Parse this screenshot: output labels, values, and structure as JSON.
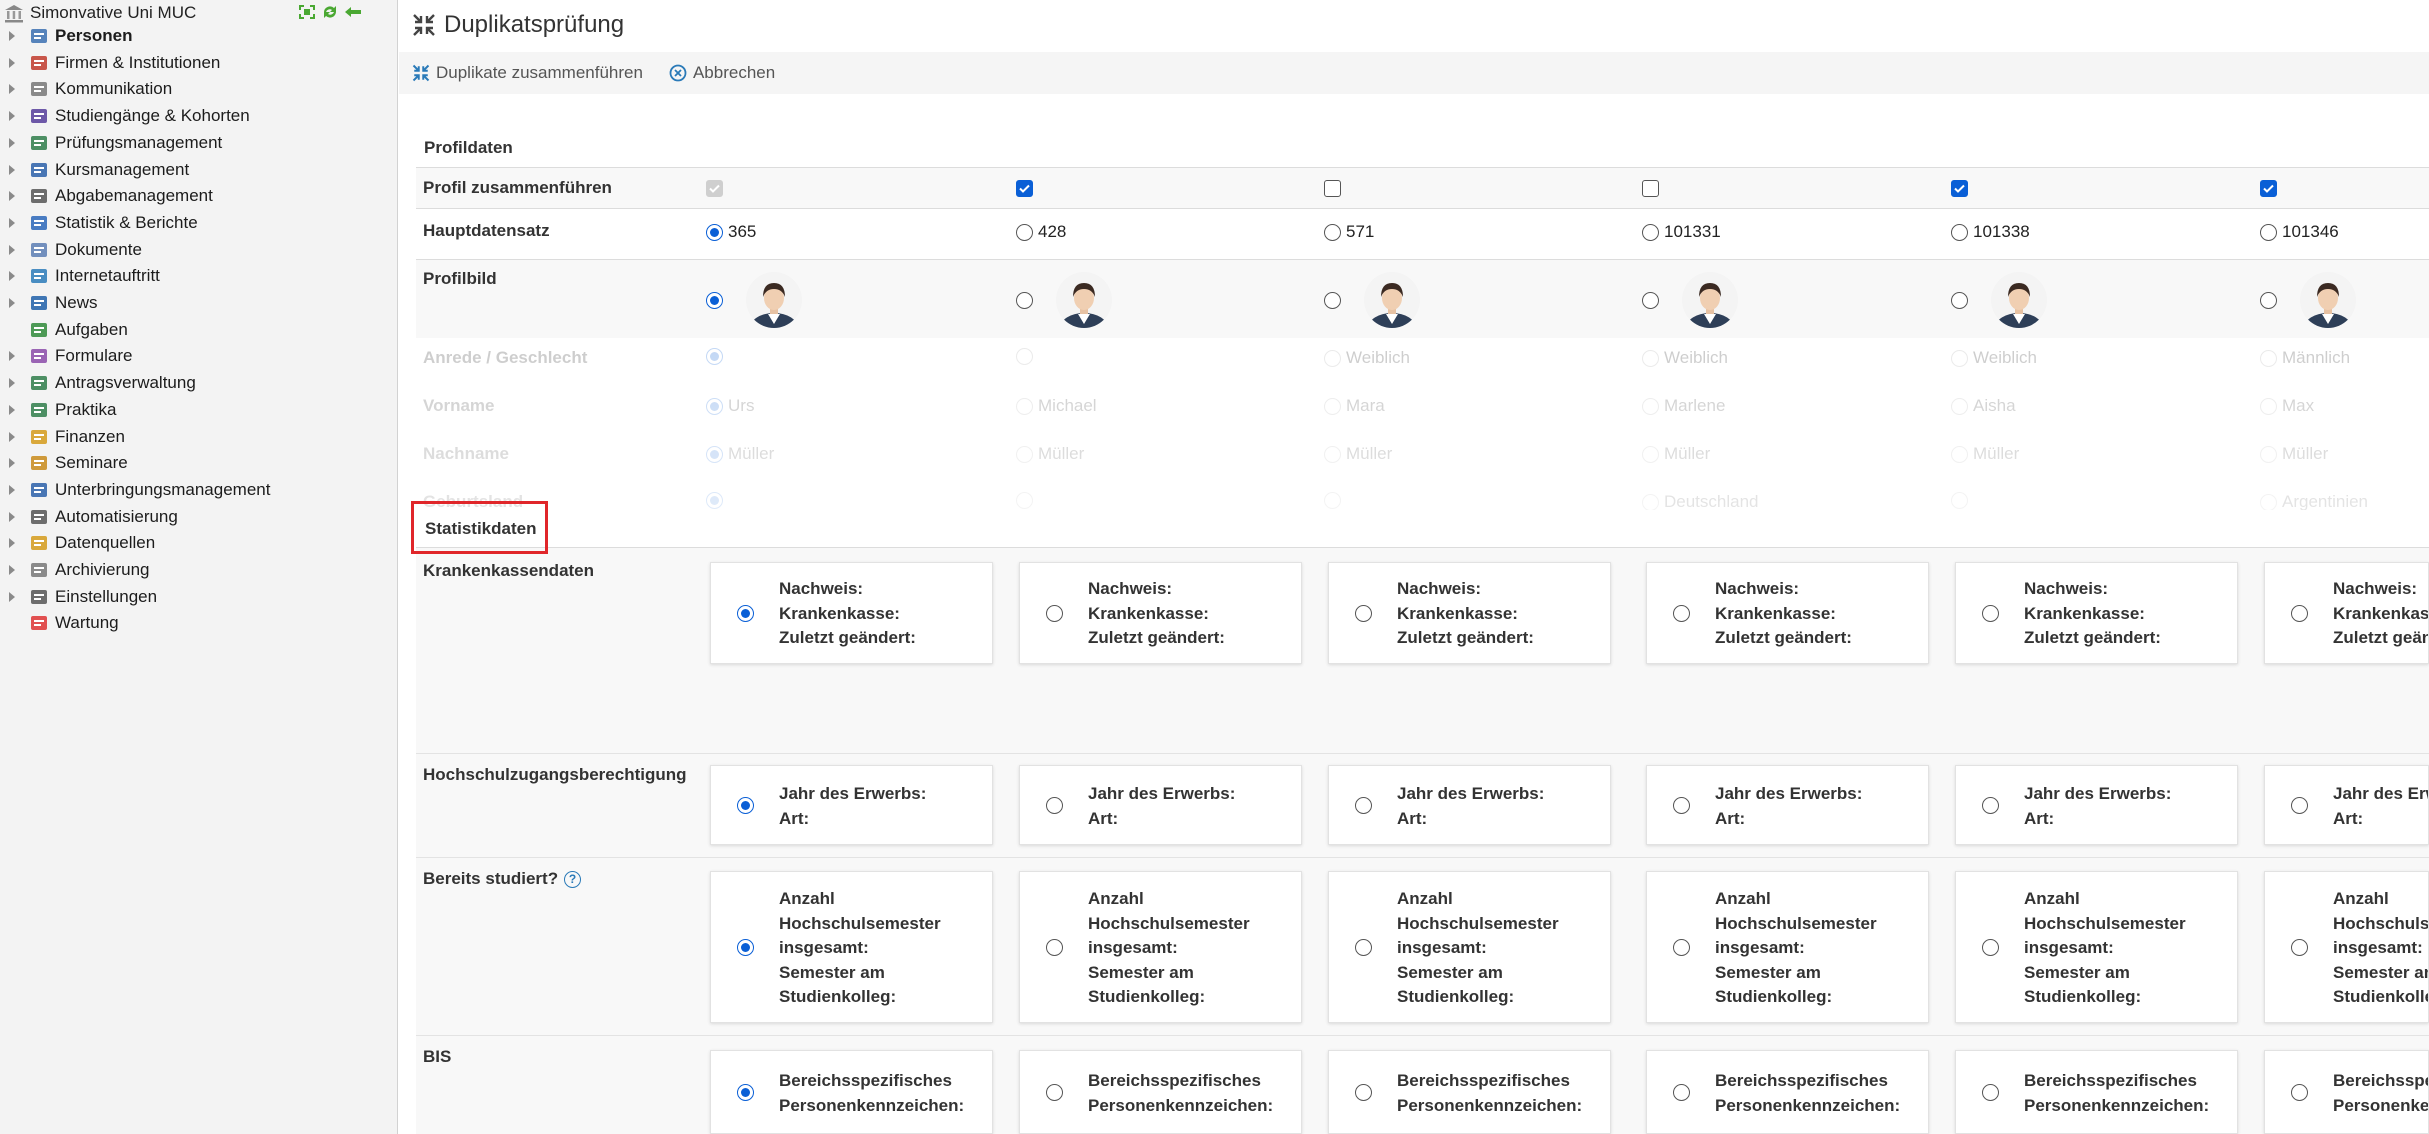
{
  "sidebar": {
    "root_label": "Simonvative Uni MUC",
    "items": [
      {
        "label": "Personen",
        "icon": "persons-icon",
        "active": true
      },
      {
        "label": "Firmen & Institutionen",
        "icon": "companies-chart-icon"
      },
      {
        "label": "Kommunikation",
        "icon": "envelope-icon"
      },
      {
        "label": "Studiengänge & Kohorten",
        "icon": "graduation-quill-icon"
      },
      {
        "label": "Prüfungsmanagement",
        "icon": "exam-checklist-icon"
      },
      {
        "label": "Kursmanagement",
        "icon": "course-book-icon"
      },
      {
        "label": "Abgabemanagement",
        "icon": "submission-card-icon"
      },
      {
        "label": "Statistik & Berichte",
        "icon": "bar-chart-icon"
      },
      {
        "label": "Dokumente",
        "icon": "folder-icon"
      },
      {
        "label": "Internetauftritt",
        "icon": "globe-icon"
      },
      {
        "label": "News",
        "icon": "info-icon"
      },
      {
        "label": "Aufgaben",
        "icon": "clock-history-icon"
      },
      {
        "label": "Formulare",
        "icon": "form-icon"
      },
      {
        "label": "Antragsverwaltung",
        "icon": "application-table-icon"
      },
      {
        "label": "Praktika",
        "icon": "internship-table-icon"
      },
      {
        "label": "Finanzen",
        "icon": "coins-icon"
      },
      {
        "label": "Seminare",
        "icon": "seminar-folder-icon"
      },
      {
        "label": "Unterbringungsmanagement",
        "icon": "building-icon"
      },
      {
        "label": "Automatisierung",
        "icon": "gear-icon"
      },
      {
        "label": "Datenquellen",
        "icon": "database-folder-icon"
      },
      {
        "label": "Archivierung",
        "icon": "archive-icon"
      },
      {
        "label": "Einstellungen",
        "icon": "settings-gear-icon"
      },
      {
        "label": "Wartung",
        "icon": "first-aid-icon"
      }
    ]
  },
  "main": {
    "title": "Duplikatsprüfung",
    "toolbar": {
      "merge_label": "Duplikate zusammenführen",
      "cancel_label": "Abbrechen"
    },
    "profile_section": {
      "heading": "Profildaten",
      "merge_row_label": "Profil zusammenführen",
      "main_record_label": "Hauptdatensatz",
      "picture_label": "Profilbild",
      "records": [
        {
          "id": "365",
          "merge": "disabled-checked",
          "main": true
        },
        {
          "id": "428",
          "merge": "checked",
          "main": false
        },
        {
          "id": "571",
          "merge": "unchecked",
          "main": false
        },
        {
          "id": "101331",
          "merge": "unchecked",
          "main": false
        },
        {
          "id": "101338",
          "merge": "checked",
          "main": false
        },
        {
          "id": "101346",
          "merge": "checked",
          "main": false
        }
      ],
      "faded_rows": [
        {
          "label": "Anrede / Geschlecht",
          "values": [
            "",
            "",
            "Weiblich",
            "Weiblich",
            "Weiblich",
            "Männlich"
          ]
        },
        {
          "label": "Vorname",
          "values": [
            "Urs",
            "Michael",
            "Mara",
            "Marlene",
            "Aisha",
            "Max"
          ]
        },
        {
          "label": "Nachname",
          "values": [
            "Müller",
            "Müller",
            "Müller",
            "Müller",
            "Müller",
            "Müller"
          ]
        },
        {
          "label": "Geburtsland",
          "values": [
            "",
            "",
            "",
            "Deutschland",
            "",
            "Argentinien"
          ]
        }
      ]
    },
    "stat_section": {
      "heading": "Statistikdaten",
      "rows": [
        {
          "label": "Krankenkassendaten",
          "help": false,
          "lines": [
            "Nachweis:",
            "Krankenkasse:",
            "Zuletzt geändert:"
          ]
        },
        {
          "label": "Hochschulzugangsberechtigung",
          "help": false,
          "lines": [
            "Jahr des Erwerbs:",
            "Art:"
          ]
        },
        {
          "label": "Bereits studiert?",
          "help": true,
          "help_glyph": "?",
          "lines": [
            "Anzahl",
            "Hochschulsemester",
            "insgesamt:",
            "Semester am",
            "Studienkolleg:"
          ]
        },
        {
          "label": "BIS",
          "help": false,
          "lines": [
            "Bereichsspezifisches",
            "Personenkennzeichen:"
          ]
        }
      ]
    }
  },
  "colors": {
    "accent": "#0a5fd6",
    "highlight": "#e0262a",
    "sidebar_bg": "#f3f3f3",
    "help": "#2a7ab8"
  }
}
